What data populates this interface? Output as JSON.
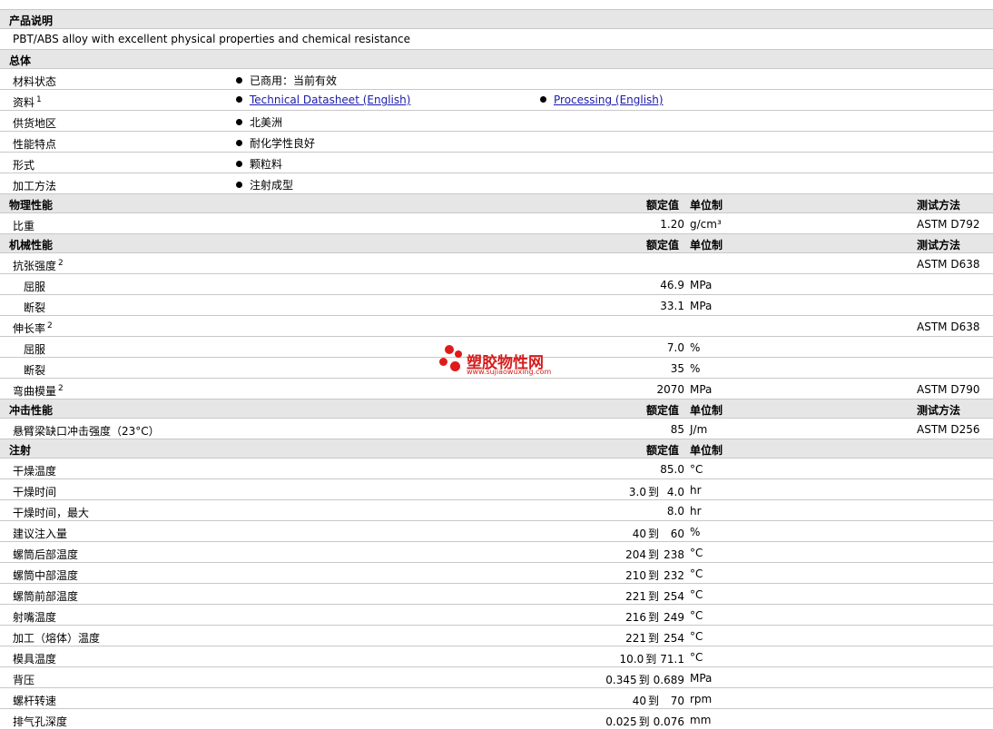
{
  "sections": {
    "desc": {
      "title": "产品说明",
      "text": "PBT/ABS alloy with excellent physical properties and chemical resistance"
    },
    "general": {
      "title": "总体",
      "rows": [
        {
          "label": "材料状态",
          "value": "已商用：当前有效"
        },
        {
          "label": "资料",
          "sup": "1",
          "link1": "Technical Datasheet (English)",
          "link2": "Processing (English)"
        },
        {
          "label": "供货地区",
          "value": "北美洲"
        },
        {
          "label": "性能特点",
          "value": "耐化学性良好"
        },
        {
          "label": "形式",
          "value": "颗粒料"
        },
        {
          "label": "加工方法",
          "value": "注射成型"
        }
      ]
    },
    "physical": {
      "title": "物理性能",
      "col_value": "额定值",
      "col_unit": "单位制",
      "col_method": "测试方法",
      "rows": [
        {
          "label": "比重",
          "value": "1.20",
          "unit": "g/cm³",
          "method": "ASTM D792"
        }
      ]
    },
    "mechanical": {
      "title": "机械性能",
      "col_value": "额定值",
      "col_unit": "单位制",
      "col_method": "测试方法",
      "rows": [
        {
          "label": "抗张强度",
          "sup": "2",
          "method": "ASTM D638"
        },
        {
          "label": "屈服",
          "sub": true,
          "value": "46.9",
          "unit": "MPa"
        },
        {
          "label": "断裂",
          "sub": true,
          "value": "33.1",
          "unit": "MPa"
        },
        {
          "label": "伸长率",
          "sup": "2",
          "method": "ASTM D638"
        },
        {
          "label": "屈服",
          "sub": true,
          "value": "7.0",
          "unit": "%"
        },
        {
          "label": "断裂",
          "sub": true,
          "value": "35",
          "unit": "%"
        },
        {
          "label": "弯曲模量",
          "sup": "2",
          "value": "2070",
          "unit": "MPa",
          "method": "ASTM D790"
        }
      ]
    },
    "impact": {
      "title": "冲击性能",
      "col_value": "额定值",
      "col_unit": "单位制",
      "col_method": "测试方法",
      "rows": [
        {
          "label": "悬臂梁缺口冲击强度（23°C）",
          "value": "85",
          "unit": "J/m",
          "method": "ASTM D256"
        }
      ]
    },
    "injection": {
      "title": "注射",
      "col_value": "额定值",
      "col_unit": "单位制",
      "rows": [
        {
          "label": "干燥温度",
          "value": "85.0",
          "unit": "°C"
        },
        {
          "label": "干燥时间",
          "v1": "3.0",
          "to": "到",
          "v2": "4.0",
          "unit": "hr"
        },
        {
          "label": "干燥时间，最大",
          "value": "8.0",
          "unit": "hr"
        },
        {
          "label": "建议注入量",
          "v1": "40",
          "to": "到",
          "v2": "60",
          "unit": "%"
        },
        {
          "label": "螺筒后部温度",
          "v1": "204",
          "to": "到",
          "v2": "238",
          "unit": "°C"
        },
        {
          "label": "螺筒中部温度",
          "v1": "210",
          "to": "到",
          "v2": "232",
          "unit": "°C"
        },
        {
          "label": "螺筒前部温度",
          "v1": "221",
          "to": "到",
          "v2": "254",
          "unit": "°C"
        },
        {
          "label": "射嘴温度",
          "v1": "216",
          "to": "到",
          "v2": "249",
          "unit": "°C"
        },
        {
          "label": "加工（熔体）温度",
          "v1": "221",
          "to": "到",
          "v2": "254",
          "unit": "°C"
        },
        {
          "label": "模具温度",
          "v1": "10.0",
          "to": "到",
          "v2": "71.1",
          "unit": "°C"
        },
        {
          "label": "背压",
          "v1": "0.345",
          "to": "到",
          "v2": "0.689",
          "unit": "MPa"
        },
        {
          "label": "螺杆转速",
          "v1": "40",
          "to": "到",
          "v2": "70",
          "unit": "rpm"
        },
        {
          "label": "排气孔深度",
          "v1": "0.025",
          "to": "到",
          "v2": "0.076",
          "unit": "mm"
        }
      ]
    }
  },
  "watermark": {
    "text": "塑胶物性网",
    "url": "www.sujiaowuxing.com",
    "color": "#d61c1c"
  }
}
